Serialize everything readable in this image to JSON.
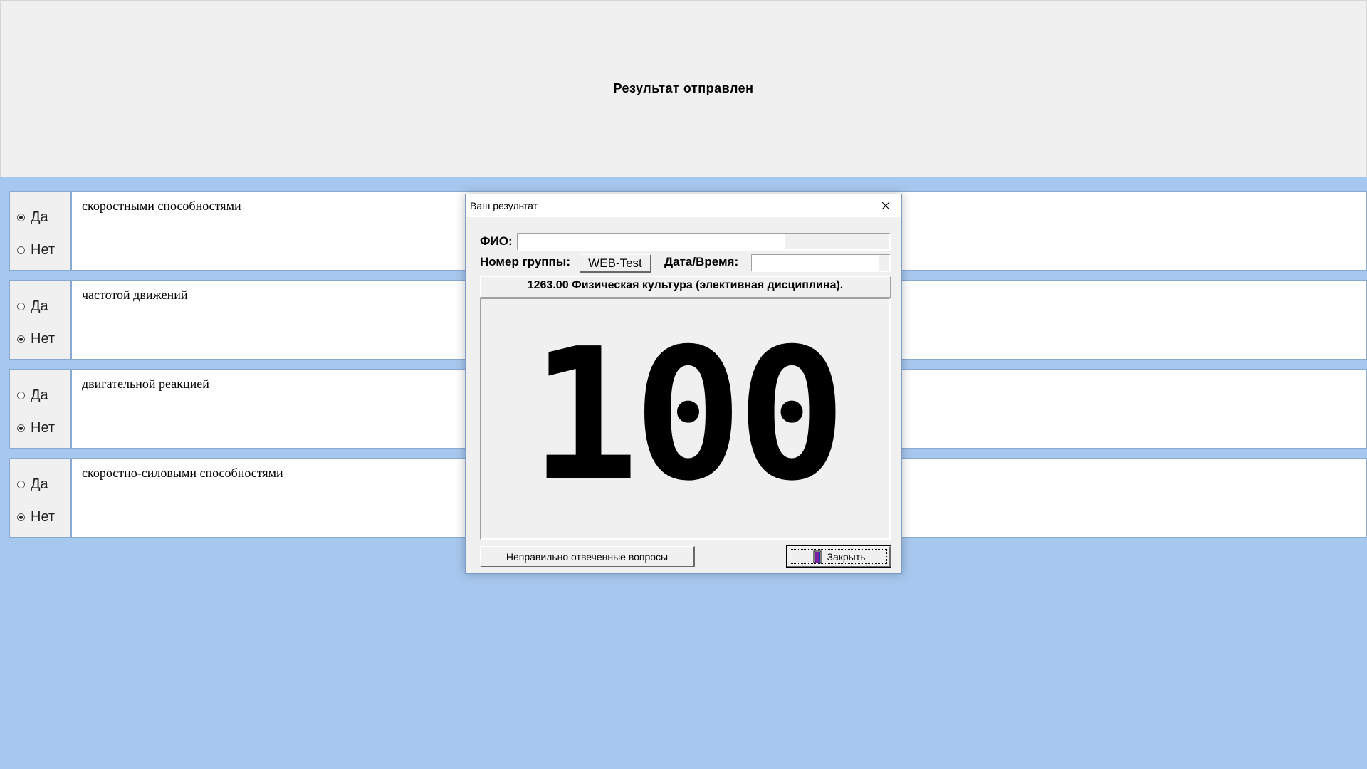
{
  "banner": {
    "message": "Результат отправлен"
  },
  "questions": [
    {
      "text": "скоростными способностями",
      "yes_label": "Да",
      "no_label": "Нет",
      "selected": "yes"
    },
    {
      "text": "частотой движений",
      "yes_label": "Да",
      "no_label": "Нет",
      "selected": "no"
    },
    {
      "text": "двигательной реакцией",
      "yes_label": "Да",
      "no_label": "Нет",
      "selected": "no"
    },
    {
      "text": "скоростно-силовыми способностями",
      "yes_label": "Да",
      "no_label": "Нет",
      "selected": "no"
    }
  ],
  "dialog": {
    "title": "Ваш результат",
    "fio_label": "ФИО:",
    "fio_value": "",
    "group_label": "Номер группы:",
    "group_value": "WEB-Test",
    "datetime_label": "Дата/Время:",
    "datetime_value": "",
    "course": "1263.00 Физическая культура (элективная дисциплина).",
    "score": "100",
    "wrong_answers_button": "Неправильно отвеченные вопросы",
    "close_button": "Закрыть"
  },
  "icons": {
    "close": "close-icon",
    "door": "door-exit-icon"
  },
  "colors": {
    "background": "#a7c8ee",
    "panel": "#f0f0f0",
    "door_icon": "#7a1fa2"
  }
}
